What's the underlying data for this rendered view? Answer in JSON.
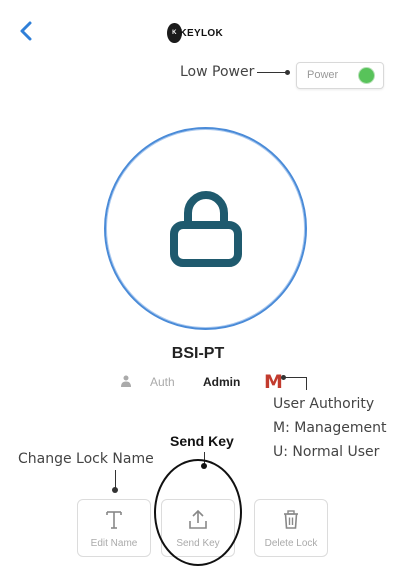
{
  "header": {
    "logo_text": "KEYLOK"
  },
  "power": {
    "label": "Power",
    "status_color": "#58c35a"
  },
  "lock": {
    "name": "BSI-PT",
    "auth_label": "Auth",
    "role": "Admin",
    "authority_badge": "M",
    "ring_color": "#4a8bd8",
    "icon_color": "#1f5a6e"
  },
  "actions": [
    {
      "label": "Edit Name",
      "icon": "text-icon"
    },
    {
      "label": "Send Key",
      "icon": "upload-icon"
    },
    {
      "label": "Delete Lock",
      "icon": "trash-icon"
    }
  ],
  "annotations": {
    "low_power": "Low Power",
    "user_authority_title": "User Authority",
    "user_authority_m": "M: Management",
    "user_authority_u": "U: Normal User",
    "send_key": "Send Key",
    "change_lock_name": "Change Lock Name"
  }
}
